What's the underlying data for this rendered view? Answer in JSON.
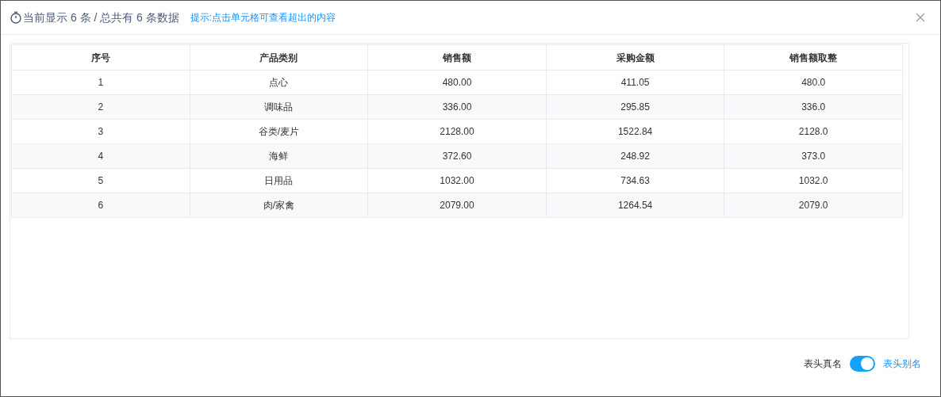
{
  "header": {
    "summary": "当前显示 6 条 / 总共有 6 条数据",
    "hint": "提示:点击单元格可查看超出的内容"
  },
  "table": {
    "columns": [
      "序号",
      "产品类别",
      "销售额",
      "采购金额",
      "销售额取整"
    ],
    "rows": [
      [
        "1",
        "点心",
        "480.00",
        "411.05",
        "480.0"
      ],
      [
        "2",
        "调味品",
        "336.00",
        "295.85",
        "336.0"
      ],
      [
        "3",
        "谷类/麦片",
        "2128.00",
        "1522.84",
        "2128.0"
      ],
      [
        "4",
        "海鲜",
        "372.60",
        "248.92",
        "373.0"
      ],
      [
        "5",
        "日用品",
        "1032.00",
        "734.63",
        "1032.0"
      ],
      [
        "6",
        "肉/家禽",
        "2079.00",
        "1264.54",
        "2079.0"
      ]
    ]
  },
  "footer": {
    "off_label": "表头真名",
    "on_label": "表头别名",
    "switch": {
      "on": true
    }
  }
}
